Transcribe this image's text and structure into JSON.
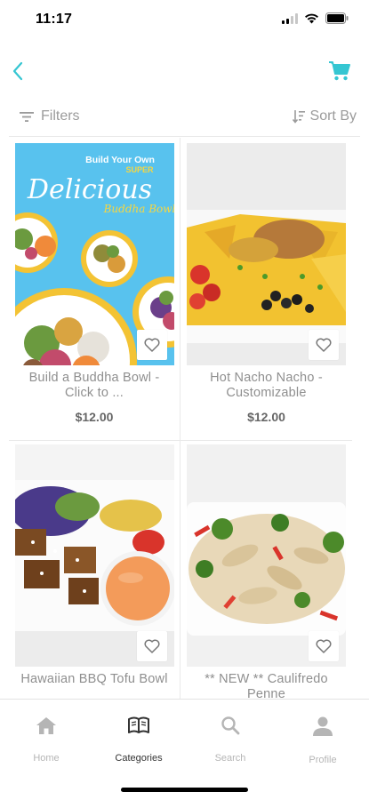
{
  "status_bar": {
    "time": "11:17"
  },
  "nav": {
    "back_icon": "chevron-left-icon",
    "cart_icon": "cart-icon",
    "accent_color": "#35c6d2"
  },
  "toolbar": {
    "filters_label": "Filters",
    "sort_label": "Sort By"
  },
  "products": [
    {
      "name": "Build a Buddha Bowl  - Click to ...",
      "price": "$12.00",
      "image": "buddha-bowl-image",
      "promo": {
        "line1": "Build Your Own",
        "line2": "SUPER",
        "line3": "Delicious",
        "line4": "Buddha Bowl"
      }
    },
    {
      "name": "Hot Nacho Nacho - Customizable",
      "price": "$12.00",
      "image": "nachos-image"
    },
    {
      "name": "Hawaiian BBQ Tofu Bowl",
      "price": "",
      "image": "tofu-bowl-image"
    },
    {
      "name": "** NEW ** Caulifredo Penne",
      "price": "",
      "image": "penne-image"
    }
  ],
  "tabs": [
    {
      "label": "Home",
      "icon": "home-icon",
      "active": false
    },
    {
      "label": "Categories",
      "icon": "book-icon",
      "active": true
    },
    {
      "label": "Search",
      "icon": "search-icon",
      "active": false
    },
    {
      "label": "Profile",
      "icon": "profile-icon",
      "active": false
    }
  ]
}
